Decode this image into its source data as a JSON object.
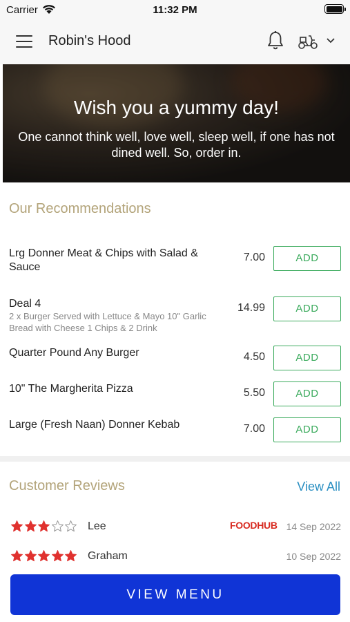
{
  "status_bar": {
    "carrier": "Carrier",
    "time": "11:32 PM"
  },
  "header": {
    "title": "Robin's Hood"
  },
  "hero": {
    "title": "Wish you a yummy day!",
    "subtitle": "One cannot think well, love well, sleep well, if one has not dined well. So, order in."
  },
  "recommendations": {
    "title": "Our Recommendations",
    "add_label": "ADD",
    "items": [
      {
        "name": "Lrg Donner Meat & Chips with Salad & Sauce",
        "description": "",
        "price": "7.00"
      },
      {
        "name": "Deal 4",
        "description": "2 x Burger Served with Lettuce & Mayo 10\" Garlic Bread with Cheese 1 Chips & 2 Drink",
        "price": "14.99"
      },
      {
        "name": "Quarter Pound Any Burger",
        "description": "",
        "price": "4.50"
      },
      {
        "name": "10\" The Margherita Pizza",
        "description": "",
        "price": "5.50"
      },
      {
        "name": "Large (Fresh Naan) Donner Kebab",
        "description": "",
        "price": "7.00"
      }
    ]
  },
  "reviews": {
    "title": "Customer Reviews",
    "view_all": "View All",
    "items": [
      {
        "name": "Lee",
        "rating": 3,
        "max_rating": 5,
        "source": "FOODHUB",
        "date": "14 Sep 2022"
      },
      {
        "name": "Graham",
        "rating": 5,
        "max_rating": 5,
        "source": "",
        "date": "10 Sep 2022"
      }
    ]
  },
  "cta": {
    "label": "VIEW MENU"
  },
  "colors": {
    "accent_gold": "#b3a47a",
    "add_green": "#3aaa5c",
    "link_blue": "#2a8fc2",
    "cta_blue": "#1034d6",
    "star_red": "#e0312e"
  }
}
